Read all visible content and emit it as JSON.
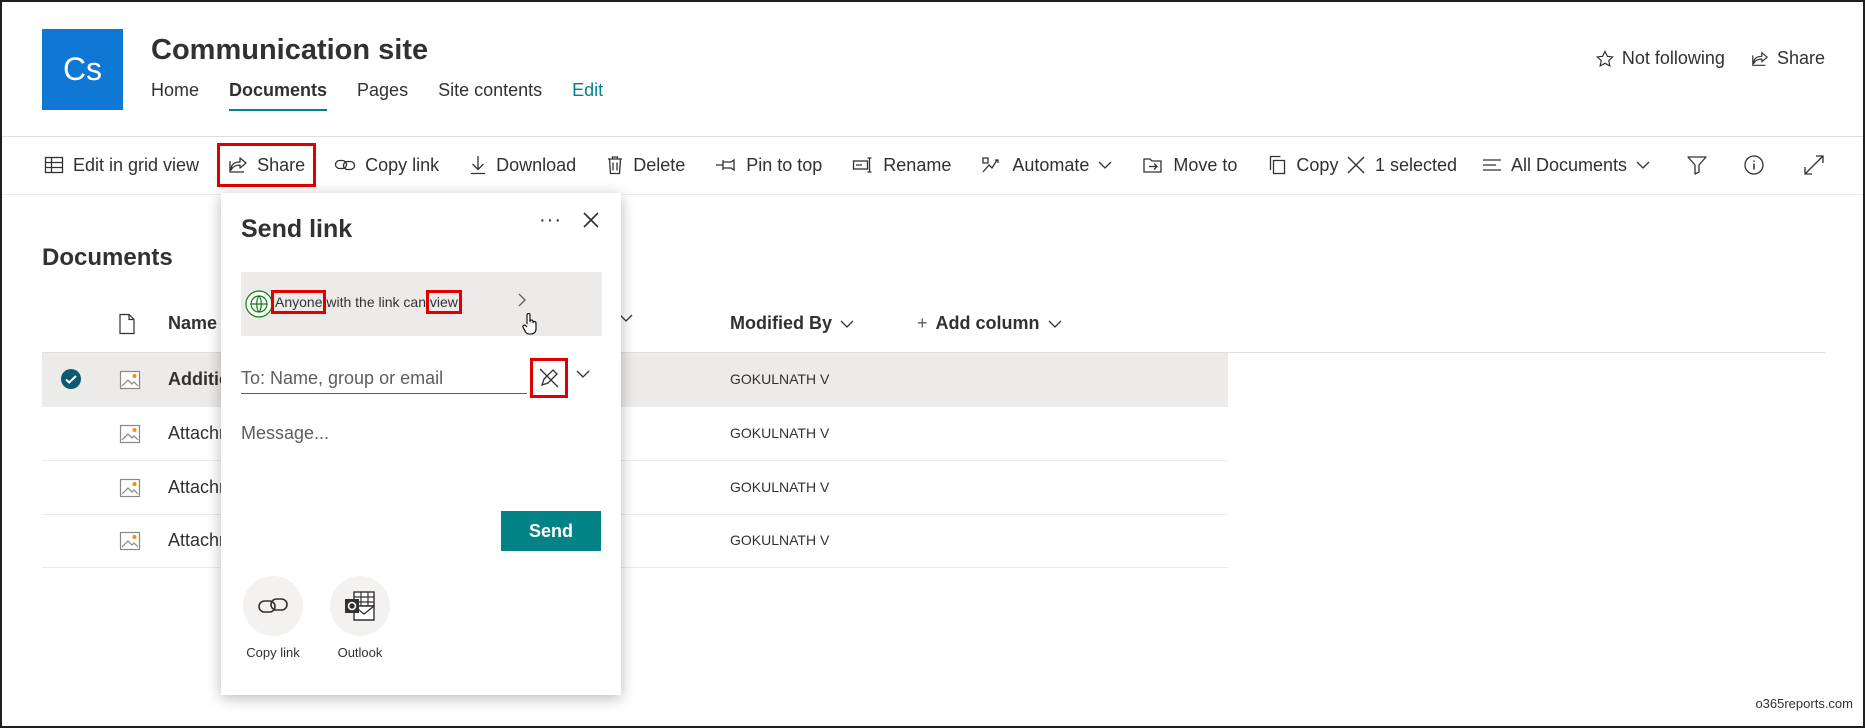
{
  "site": {
    "logo_text": "Cs",
    "title": "Communication site",
    "nav": [
      "Home",
      "Documents",
      "Pages",
      "Site contents",
      "Edit"
    ],
    "not_following": "Not following",
    "share": "Share"
  },
  "commandbar": {
    "edit_grid": "Edit in grid view",
    "share": "Share",
    "copy_link": "Copy link",
    "download": "Download",
    "delete": "Delete",
    "pin": "Pin to top",
    "rename": "Rename",
    "automate": "Automate",
    "move_to": "Move to",
    "copy": "Copy",
    "selected": "1 selected",
    "view": "All Documents"
  },
  "library": {
    "title": "Documents",
    "columns": {
      "name": "Name",
      "modified_by": "Modified By",
      "add_column": "Add column"
    },
    "rows": [
      {
        "name": "Additic",
        "modified_by": "GOKULNATH V",
        "selected": true
      },
      {
        "name": "Attachn",
        "modified_by": "GOKULNATH V",
        "selected": false
      },
      {
        "name": "Attachn",
        "modified_by": "GOKULNATH V",
        "selected": false
      },
      {
        "name": "Attachn",
        "modified_by": "GOKULNATH V",
        "selected": false
      }
    ]
  },
  "share_panel": {
    "title": "Send link",
    "more": "···",
    "perm_anyone": "Anyone",
    "perm_middle": " with the link can ",
    "perm_view": "view",
    "to_placeholder": "To: Name, group or email",
    "message_placeholder": "Message...",
    "send": "Send",
    "copy_link": "Copy link",
    "outlook": "Outlook"
  },
  "colors": {
    "accent": "#038387",
    "brand": "#0f78d4",
    "highlight": "#e00000"
  },
  "watermark": "o365reports.com"
}
